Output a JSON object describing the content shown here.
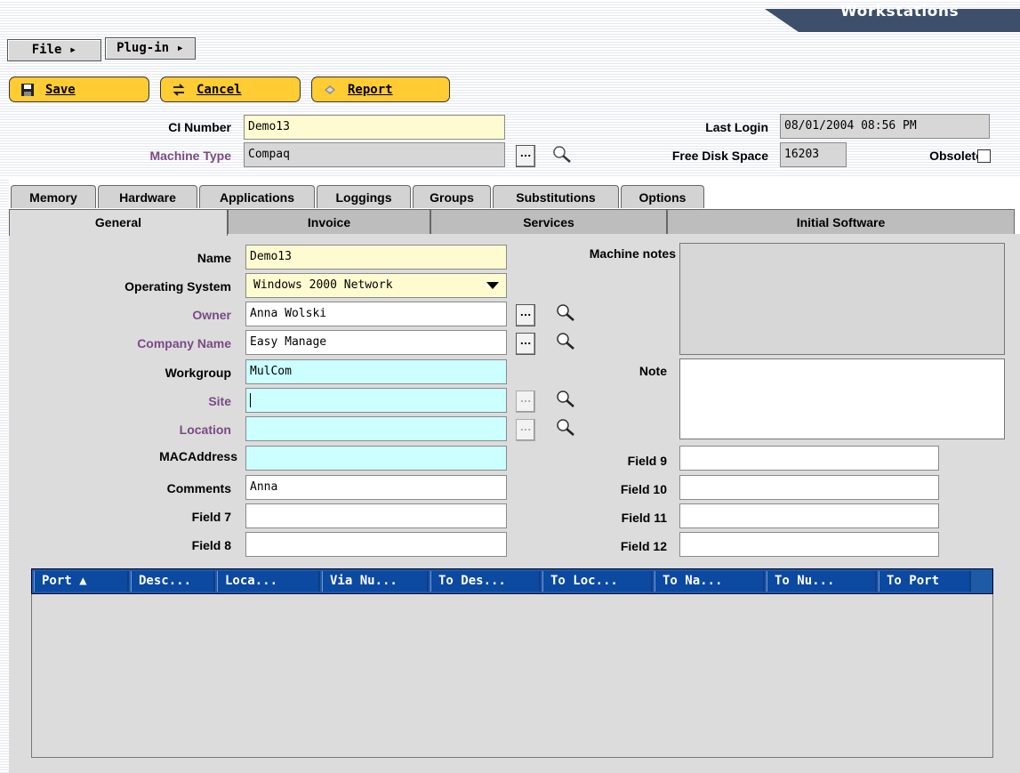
{
  "window_title": "Workstations",
  "menu": {
    "file": "File ▸",
    "plugin": "Plug-in ▸"
  },
  "toolbar": {
    "save": "Save",
    "cancel": "Cancel",
    "report": "Report"
  },
  "header": {
    "ci_number_label": "CI Number",
    "ci_number_value": "Demo13",
    "machine_type_label": "Machine Type",
    "machine_type_value": "Compaq",
    "last_login_label": "Last Login",
    "last_login_value": "08/01/2004 08:56 PM",
    "free_disk_label": "Free Disk Space",
    "free_disk_value": "16203",
    "obsolete_label": "Obsolete"
  },
  "tabs_top": [
    "Memory",
    "Hardware",
    "Applications",
    "Loggings",
    "Groups",
    "Substitutions",
    "Options"
  ],
  "tabs_bottom": [
    "General",
    "Invoice",
    "Services",
    "Initial Software"
  ],
  "form": {
    "name_label": "Name",
    "name_value": "Demo13",
    "os_label": "Operating System",
    "os_value": "Windows 2000 Network",
    "owner_label": "Owner",
    "owner_value": "Anna Wolski",
    "company_label": "Company Name",
    "company_value": "Easy Manage",
    "workgroup_label": "Workgroup",
    "workgroup_value": "MulCom",
    "site_label": "Site",
    "site_value": "",
    "location_label": "Location",
    "location_value": "",
    "mac_label": "MACAddress",
    "mac_value": "",
    "comments_label": "Comments",
    "comments_value": "Anna",
    "field7_label": "Field 7",
    "field7_value": "",
    "field8_label": "Field 8",
    "field8_value": "",
    "machine_notes_label": "Machine notes",
    "note_label": "Note",
    "field9_label": "Field 9",
    "field10_label": "Field 10",
    "field11_label": "Field 11",
    "field12_label": "Field 12"
  },
  "grid": {
    "columns": [
      "Port  ▲",
      "Desc...",
      "Loca...",
      "Via Nu...",
      "To Des...",
      "To Loc...",
      "To Na...",
      "To Nu...",
      "To Port"
    ]
  },
  "colors": {
    "accent_button": "#ffcc33",
    "grid_header": "#0c49a0",
    "title_bar": "#3d4f6b"
  },
  "ellipsis": "..."
}
